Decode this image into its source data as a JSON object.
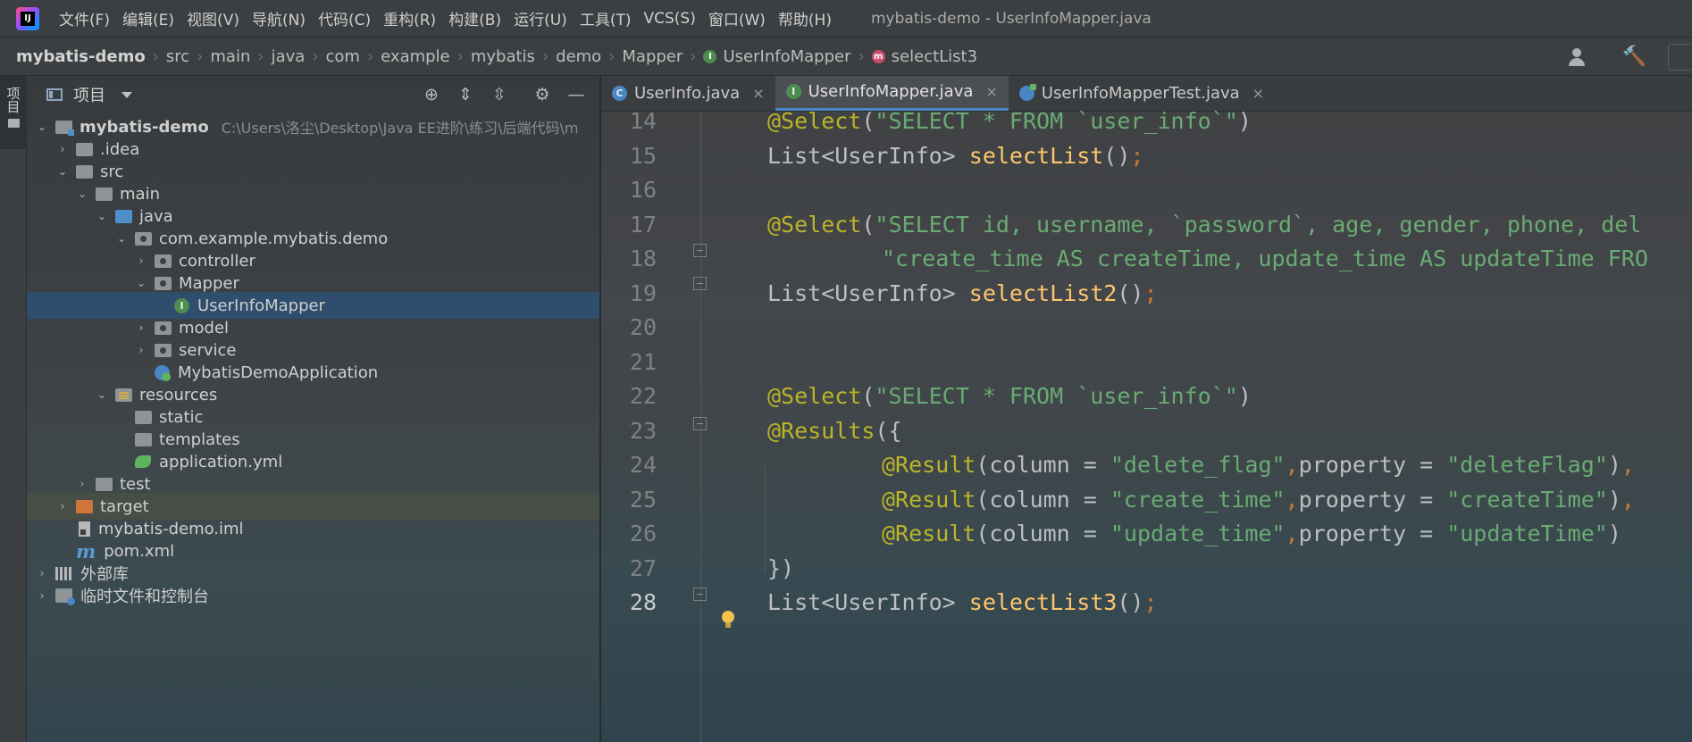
{
  "menubar": {
    "logo_text": "IJ",
    "items": [
      "文件(F)",
      "编辑(E)",
      "视图(V)",
      "导航(N)",
      "代码(C)",
      "重构(R)",
      "构建(B)",
      "运行(U)",
      "工具(T)",
      "VCS(S)",
      "窗口(W)",
      "帮助(H)"
    ],
    "window_title": "mybatis-demo - UserInfoMapper.java"
  },
  "breadcrumb": [
    "mybatis-demo",
    "src",
    "main",
    "java",
    "com",
    "example",
    "mybatis",
    "demo",
    "Mapper",
    "UserInfoMapper",
    "selectList3"
  ],
  "tool_stripe": {
    "project_label": "项目"
  },
  "project_panel": {
    "title": "项目",
    "tree": [
      {
        "label": "mybatis-demo",
        "hint": "C:\\Users\\洛尘\\Desktop\\Java EE进阶\\练习\\后端代码\\m",
        "icon": "module-folder-icon",
        "arrow": "expanded"
      },
      {
        "label": ".idea",
        "icon": "folder-icon",
        "arrow": "collapsed"
      },
      {
        "label": "src",
        "icon": "folder-icon",
        "arrow": "expanded"
      },
      {
        "label": "main",
        "icon": "folder-icon",
        "arrow": "expanded"
      },
      {
        "label": "java",
        "icon": "source-folder-icon",
        "arrow": "expanded"
      },
      {
        "label": "com.example.mybatis.demo",
        "icon": "package-icon",
        "arrow": "expanded"
      },
      {
        "label": "controller",
        "icon": "package-icon",
        "arrow": "collapsed"
      },
      {
        "label": "Mapper",
        "icon": "package-icon",
        "arrow": "expanded"
      },
      {
        "label": "UserInfoMapper",
        "icon": "interface-icon",
        "arrow": "none"
      },
      {
        "label": "model",
        "icon": "package-icon",
        "arrow": "collapsed"
      },
      {
        "label": "service",
        "icon": "package-icon",
        "arrow": "collapsed"
      },
      {
        "label": "MybatisDemoApplication",
        "icon": "spring-boot-class-icon",
        "arrow": "none"
      },
      {
        "label": "resources",
        "icon": "resources-folder-icon",
        "arrow": "expanded"
      },
      {
        "label": "static",
        "icon": "folder-icon",
        "arrow": "none"
      },
      {
        "label": "templates",
        "icon": "folder-icon",
        "arrow": "none"
      },
      {
        "label": "application.yml",
        "icon": "yaml-file-icon",
        "arrow": "none"
      },
      {
        "label": "test",
        "icon": "folder-icon",
        "arrow": "collapsed"
      },
      {
        "label": "target",
        "icon": "excluded-folder-icon",
        "arrow": "collapsed"
      },
      {
        "label": "mybatis-demo.iml",
        "icon": "iml-file-icon",
        "arrow": "none"
      },
      {
        "label": "pom.xml",
        "icon": "maven-icon",
        "arrow": "none"
      },
      {
        "label": "外部库",
        "icon": "library-icon",
        "arrow": "collapsed"
      },
      {
        "label": "临时文件和控制台",
        "icon": "scratch-icon",
        "arrow": "collapsed"
      }
    ]
  },
  "editor": {
    "tabs": [
      {
        "label": "UserInfo.java",
        "active": false
      },
      {
        "label": "UserInfoMapper.java",
        "active": true
      },
      {
        "label": "UserInfoMapperTest.java",
        "active": false
      }
    ],
    "tab_close_glyph": "×",
    "line_numbers": [
      "14",
      "15",
      "16",
      "17",
      "18",
      "19",
      "20",
      "21",
      "22",
      "23",
      "24",
      "25",
      "26",
      "27",
      "28"
    ],
    "current_line": "28",
    "code": {
      "l14_ann": "@Select",
      "l14_open": "(",
      "l14_str": "\"SELECT * FROM `user_info`\"",
      "l14_close": ")",
      "l15_type": "List<UserInfo> ",
      "l15_fn": "selectList",
      "l15_paren": "()",
      "l15_semi": ";",
      "l17_ann": "@Select",
      "l17_open": "(",
      "l17_str": "\"SELECT id, username, `password`, age, gender, phone, del",
      "l18_str": "\"create_time AS createTime, update_time AS updateTime FRO",
      "l19_type": "List<UserInfo> ",
      "l19_fn": "selectList2",
      "l19_paren": "()",
      "l19_semi": ";",
      "l22_ann": "@Select",
      "l22_open": "(",
      "l22_str": "\"SELECT * FROM `user_info`\"",
      "l22_close": ")",
      "l23_ann": "@Results",
      "l23_rest": "({",
      "l24_ann": "@Result",
      "l24_a": "(column = ",
      "l24_s1": "\"delete_flag\"",
      "l24_comma": ",",
      "l24_b": "property = ",
      "l24_s2": "\"deleteFlag\"",
      "l24_c": ")",
      "l24_end": ",",
      "l25_ann": "@Result",
      "l25_a": "(column = ",
      "l25_s1": "\"create_time\"",
      "l25_comma": ",",
      "l25_b": "property = ",
      "l25_s2": "\"createTime\"",
      "l25_c": ")",
      "l25_end": ",",
      "l26_ann": "@Result",
      "l26_a": "(column = ",
      "l26_s1": "\"update_time\"",
      "l26_comma": ",",
      "l26_b": "property = ",
      "l26_s2": "\"updateTime\"",
      "l26_c": ")",
      "l27_text": "})",
      "l28_type": "List<UserInfo> ",
      "l28_fn": "selectList3",
      "l28_paren": "()",
      "l28_semi": ";"
    }
  },
  "colors": {
    "annotation": "#bbb529",
    "string": "#6aab73",
    "method": "#ffc66d",
    "keyword_separator": "#cc7832",
    "selection": "#2f4d6c",
    "accent": "#4a88c7"
  }
}
